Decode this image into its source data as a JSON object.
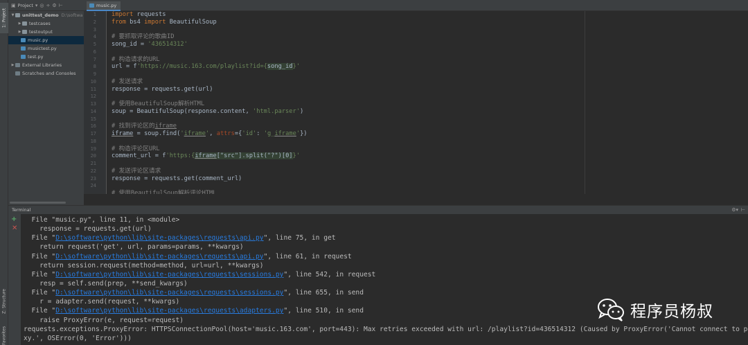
{
  "tool_windows": {
    "project": "1: Project",
    "structure": "Z: Structure",
    "favorites": "Favorites"
  },
  "project_panel": {
    "title": "Project",
    "tree": [
      {
        "label": "unittest_demo",
        "path": "D:\\softwa",
        "type": "project"
      },
      {
        "label": "testcases",
        "type": "folder"
      },
      {
        "label": "testoutput",
        "type": "folder"
      },
      {
        "label": "music.py",
        "type": "py",
        "selected": true
      },
      {
        "label": "musictest.py",
        "type": "py"
      },
      {
        "label": "test.py",
        "type": "py"
      },
      {
        "label": "External Libraries",
        "type": "lib"
      },
      {
        "label": "Scratches and Consoles",
        "type": "scratch"
      }
    ]
  },
  "editor": {
    "tab": "music.py",
    "line_numbers": [
      "1",
      "2",
      "3",
      "4",
      "5",
      "6",
      "7",
      "8",
      "9",
      "10",
      "11",
      "12",
      "13",
      "14",
      "15",
      "16",
      "17",
      "18",
      "19",
      "20",
      "21",
      "22",
      "23",
      "24"
    ],
    "lines": [
      "import requests",
      "from bs4 import BeautifulSoup",
      "",
      "# 要抓取评论的歌曲ID",
      "song_id = '436514312'",
      "",
      "# 构造请求的URL",
      "url = f'https://music.163.com/playlist?id={song_id}'",
      "",
      "# 发送请求",
      "response = requests.get(url)",
      "",
      "# 使用BeautifulSoup解析HTML",
      "soup = BeautifulSoup(response.content, 'html.parser')",
      "",
      "# 找到评论区的iframe",
      "iframe = soup.find('iframe', attrs={'id': 'g_iframe'})",
      "",
      "# 构造评论区URL",
      "comment_url = f'https:{iframe[\"src\"].split(\"?\")[0]}'",
      "",
      "# 发送评论区请求",
      "response = requests.get(comment_url)",
      "",
      "# 使用BeautifulSoup解析评论HTML"
    ]
  },
  "terminal": {
    "title": "Terminal",
    "output": [
      {
        "text": "  File \"music.py\", line 11, in <module>"
      },
      {
        "text": "    response = requests.get(url)"
      },
      {
        "pre": "  File \"",
        "link": "D:\\software\\python\\lib\\site-packages\\requests\\api.py",
        "post": "\", line 75, in get"
      },
      {
        "text": "    return request('get', url, params=params, **kwargs)"
      },
      {
        "pre": "  File \"",
        "link": "D:\\software\\python\\lib\\site-packages\\requests\\api.py",
        "post": "\", line 61, in request"
      },
      {
        "text": "    return session.request(method=method, url=url, **kwargs)"
      },
      {
        "pre": "  File \"",
        "link": "D:\\software\\python\\lib\\site-packages\\requests\\sessions.py",
        "post": "\", line 542, in request"
      },
      {
        "text": "    resp = self.send(prep, **send_kwargs)"
      },
      {
        "pre": "  File \"",
        "link": "D:\\software\\python\\lib\\site-packages\\requests\\sessions.py",
        "post": "\", line 655, in send"
      },
      {
        "text": "    r = adapter.send(request, **kwargs)"
      },
      {
        "pre": "  File \"",
        "link": "D:\\software\\python\\lib\\site-packages\\requests\\adapters.py",
        "post": "\", line 510, in send"
      },
      {
        "text": "    raise ProxyError(e, request=request)"
      },
      {
        "text": "requests.exceptions.ProxyError: HTTPSConnectionPool(host='music.163.com', port=443): Max retries exceeded with url: /playlist?id=436514312 (Caused by ProxyError('Cannot connect to pro"
      },
      {
        "text": "xy.', OSError(0, 'Error')))"
      }
    ]
  },
  "watermark": "程序员杨叔",
  "icons": {
    "project_header": [
      "chevron-down-icon",
      "target-icon",
      "split-icon",
      "gear-icon",
      "hide-icon"
    ],
    "terminal": [
      "add-icon",
      "close-icon",
      "gear-icon",
      "minimize-icon"
    ]
  },
  "colors": {
    "keyword": "#cc7832",
    "comment": "#808080",
    "string": "#6a8759",
    "param": "#aa4926",
    "link": "#287bde",
    "selection": "#0d293e"
  }
}
